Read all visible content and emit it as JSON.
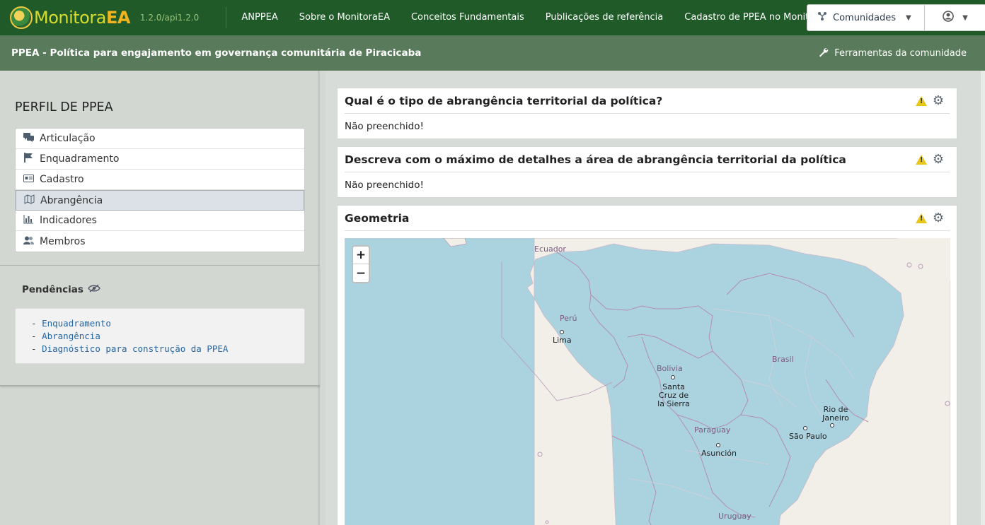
{
  "topbar": {
    "logo_main": "Monitora",
    "logo_accent": "EA",
    "version": "1.2.0/api1.2.0",
    "nav": [
      "ANPPEA",
      "Sobre o MonitoraEA",
      "Conceitos Fundamentais",
      "Publicações de referência",
      "Cadastro de PPEA no MonitoraEA"
    ],
    "communities_label": "Comunidades",
    "communities_icon": "share-nodes-icon",
    "user_icon": "user-circle-icon"
  },
  "titlebar": {
    "title": "PPEA - Política para engajamento em governança comunitária de Piracicaba",
    "tools_label": "Ferramentas da comunidade",
    "tools_icon": "wrench-icon"
  },
  "sidebar": {
    "profile_title": "PERFIL DE PPEA",
    "menu": [
      {
        "label": "Articulação",
        "icon": "comments-icon",
        "active": false
      },
      {
        "label": "Enquadramento",
        "icon": "flag-icon",
        "active": false
      },
      {
        "label": "Cadastro",
        "icon": "id-card-icon",
        "active": false
      },
      {
        "label": "Abrangência",
        "icon": "map-icon",
        "active": true
      },
      {
        "label": "Indicadores",
        "icon": "bar-chart-icon",
        "active": false
      },
      {
        "label": "Membros",
        "icon": "users-icon",
        "active": false
      }
    ],
    "pendencias_title": "Pendências",
    "pendencias": [
      "Enquadramento",
      "Abrangência",
      "Diagnóstico para construção da PPEA"
    ]
  },
  "cards": [
    {
      "title": "Qual é o tipo de abrangência territorial da política?",
      "body": "Não preenchido!"
    },
    {
      "title": "Descreva com o máximo de detalhes a área de abrangência territorial da política",
      "body": "Não preenchido!"
    },
    {
      "title": "Geometria",
      "body": ""
    }
  ],
  "map": {
    "zoom_in": "+",
    "zoom_out": "−",
    "labels": {
      "ecuador": "Ecuador",
      "peru": "Perú",
      "lima": "Lima",
      "bolivia": "Bolivia",
      "santa_cruz": "Santa Cruz de la Sierra",
      "brasil": "Brasil",
      "rio": "Rio de Janeiro",
      "sao_paulo": "São Paulo",
      "paraguay": "Paraguay",
      "asuncion": "Asunción",
      "uruguay": "Uruguay"
    }
  },
  "colors": {
    "nav_bg": "#1f5a28",
    "title_bg": "#5a7a5c",
    "warning": "#e7c61a",
    "ocean": "#aad3df",
    "land": "#f2efe9"
  }
}
